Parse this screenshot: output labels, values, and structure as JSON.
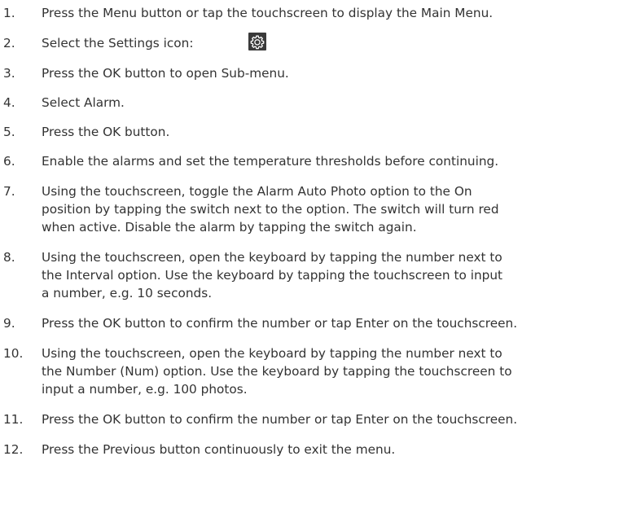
{
  "steps": [
    {
      "num": "1.",
      "lines": [
        "Press the Menu button or tap the touchscreen to display the Main Menu."
      ]
    },
    {
      "num": "2.",
      "lines": [
        "Select the Settings icon:"
      ],
      "icon": "settings-gear-icon"
    },
    {
      "num": "3.",
      "lines": [
        "Press the OK button to open Sub-menu."
      ]
    },
    {
      "num": "4.",
      "lines": [
        "Select Alarm."
      ]
    },
    {
      "num": "5.",
      "lines": [
        "Press the OK button."
      ]
    },
    {
      "num": "6.",
      "lines": [
        "Enable the alarms and set the temperature thresholds before continuing."
      ]
    },
    {
      "num": "7.",
      "lines": [
        "Using the touchscreen, toggle the Alarm Auto Photo option to the On",
        "position by tapping the switch next to the option. The switch will turn red",
        "when active. Disable the alarm by tapping the switch again."
      ]
    },
    {
      "num": "8.",
      "lines": [
        "Using the touchscreen, open the keyboard by tapping the number next to",
        "the Interval option. Use the keyboard by tapping the touchscreen to input",
        "a number, e.g. 10 seconds."
      ]
    },
    {
      "num": "9.",
      "lines": [
        "Press the OK button to confirm the number or tap Enter on the touchscreen."
      ]
    },
    {
      "num": "10.",
      "lines": [
        "Using the touchscreen, open the keyboard by tapping the number next to",
        "the Number (Num) option. Use the keyboard by tapping the touchscreen to",
        "input a number,  e.g. 100 photos."
      ]
    },
    {
      "num": "11.",
      "lines": [
        "Press the OK button to confirm the number or tap Enter on the touchscreen."
      ]
    },
    {
      "num": "12.",
      "lines": [
        "Press the Previous button continuously to exit the menu."
      ]
    }
  ]
}
